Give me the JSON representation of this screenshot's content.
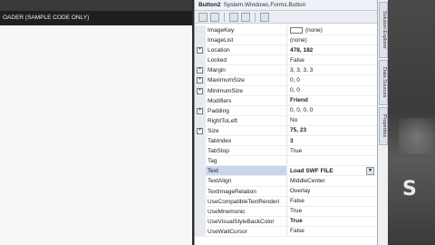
{
  "designer": {
    "form_title": "OADER (SAMPLE CODE ONLY)"
  },
  "properties": {
    "object_name": "Button2",
    "object_type": "System.Windows.Forms.Button",
    "rows": [
      {
        "name": "ImageKey",
        "value": "(none)",
        "expand": false,
        "bold": false,
        "swatch": true
      },
      {
        "name": "ImageList",
        "value": "(none)",
        "expand": false,
        "bold": false
      },
      {
        "name": "Location",
        "value": "478, 182",
        "expand": true,
        "bold": true
      },
      {
        "name": "Locked",
        "value": "False",
        "expand": false,
        "bold": false
      },
      {
        "name": "Margin",
        "value": "3, 3, 3, 3",
        "expand": true,
        "bold": false
      },
      {
        "name": "MaximumSize",
        "value": "0, 0",
        "expand": true,
        "bold": false
      },
      {
        "name": "MinimumSize",
        "value": "0, 0",
        "expand": true,
        "bold": false
      },
      {
        "name": "Modifiers",
        "value": "Friend",
        "expand": false,
        "bold": true
      },
      {
        "name": "Padding",
        "value": "0, 0, 0, 0",
        "expand": true,
        "bold": false
      },
      {
        "name": "RightToLeft",
        "value": "No",
        "expand": false,
        "bold": false
      },
      {
        "name": "Size",
        "value": "75, 23",
        "expand": true,
        "bold": true
      },
      {
        "name": "TabIndex",
        "value": "3",
        "expand": false,
        "bold": true
      },
      {
        "name": "TabStop",
        "value": "True",
        "expand": false,
        "bold": false
      },
      {
        "name": "Tag",
        "value": "",
        "expand": false,
        "bold": false
      },
      {
        "name": "Text",
        "value": "Load SWF FILE",
        "expand": false,
        "bold": true,
        "selected": true,
        "dropdown": true
      },
      {
        "name": "TextAlign",
        "value": "MiddleCenter",
        "expand": false,
        "bold": false
      },
      {
        "name": "TextImageRelation",
        "value": "Overlay",
        "expand": false,
        "bold": false
      },
      {
        "name": "UseCompatibleTextRenderi",
        "value": "False",
        "expand": false,
        "bold": false
      },
      {
        "name": "UseMnemonic",
        "value": "True",
        "expand": false,
        "bold": false
      },
      {
        "name": "UseVisualStyleBackColor",
        "value": "True",
        "expand": false,
        "bold": true
      },
      {
        "name": "UseWaitCursor",
        "value": "False",
        "expand": false,
        "bold": false
      }
    ]
  },
  "dock_tabs": [
    "Solution Explorer",
    "Data Sources",
    "Properties"
  ],
  "desktop": {
    "letter": "S"
  }
}
